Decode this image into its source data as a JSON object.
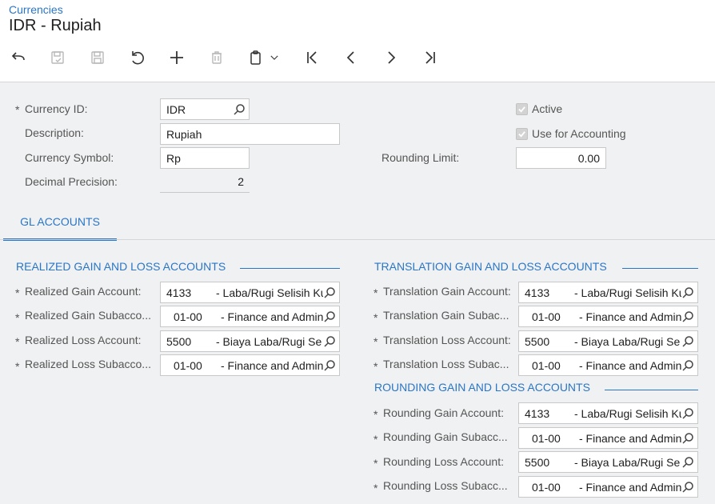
{
  "header": {
    "breadcrumb": "Currencies",
    "title": "IDR - Rupiah"
  },
  "toolbar": {
    "icons": [
      "back-arrow-icon",
      "save-close-icon",
      "save-icon",
      "undo-icon",
      "add-icon",
      "delete-icon",
      "copy-paste-icon",
      "chevron-down-icon",
      "first-record-icon",
      "previous-record-icon",
      "next-record-icon",
      "last-record-icon"
    ]
  },
  "form": {
    "currency_id": {
      "label": "Currency ID:",
      "required": "*",
      "value": "IDR"
    },
    "description": {
      "label": "Description:",
      "value": "Rupiah"
    },
    "currency_symbol": {
      "label": "Currency Symbol:",
      "value": "Rp"
    },
    "decimal_precision": {
      "label": "Decimal Precision:",
      "value": "2"
    },
    "active": {
      "label": "Active",
      "checked": true
    },
    "use_for_accounting": {
      "label": "Use for Accounting",
      "checked": true
    },
    "rounding_limit": {
      "label": "Rounding Limit:",
      "value": "0.00"
    }
  },
  "tabs": [
    {
      "label": "GL ACCOUNTS",
      "selected": true
    }
  ],
  "realized": {
    "title": "REALIZED GAIN AND LOSS ACCOUNTS",
    "rows": [
      {
        "label": "Realized Gain Account:",
        "code": "4133",
        "desc": "- Laba/Rugi Selisih Ku"
      },
      {
        "label": "Realized Gain Subacco...",
        "code": "01-00",
        "desc": "- Finance and Admin"
      },
      {
        "label": "Realized Loss Account:",
        "code": "5500",
        "desc": "- Biaya Laba/Rugi Se"
      },
      {
        "label": "Realized Loss Subacco...",
        "code": "01-00",
        "desc": "- Finance and Admin"
      }
    ]
  },
  "translation": {
    "title": "TRANSLATION GAIN AND LOSS ACCOUNTS",
    "rows": [
      {
        "label": "Translation Gain Account:",
        "code": "4133",
        "desc": "- Laba/Rugi Selisih Ku"
      },
      {
        "label": "Translation Gain Subac...",
        "code": "01-00",
        "desc": "- Finance and Admin"
      },
      {
        "label": "Translation Loss Account:",
        "code": "5500",
        "desc": "- Biaya Laba/Rugi Se"
      },
      {
        "label": "Translation Loss Subac...",
        "code": "01-00",
        "desc": "- Finance and Admin"
      }
    ]
  },
  "rounding": {
    "title": "ROUNDING GAIN AND LOSS ACCOUNTS",
    "rows": [
      {
        "label": "Rounding Gain Account:",
        "code": "4133",
        "desc": "- Laba/Rugi Selisih Ku"
      },
      {
        "label": "Rounding Gain Subacc...",
        "code": "01-00",
        "desc": "- Finance and Admin"
      },
      {
        "label": "Rounding Loss Account:",
        "code": "5500",
        "desc": "- Biaya Laba/Rugi Se"
      },
      {
        "label": "Rounding Loss Subacc...",
        "code": "01-00",
        "desc": "- Finance and Admin"
      }
    ]
  },
  "required_marker": "*",
  "colors": {
    "accent": "#2a76c6",
    "background": "#f0f1f2",
    "header": "#ffffff"
  }
}
